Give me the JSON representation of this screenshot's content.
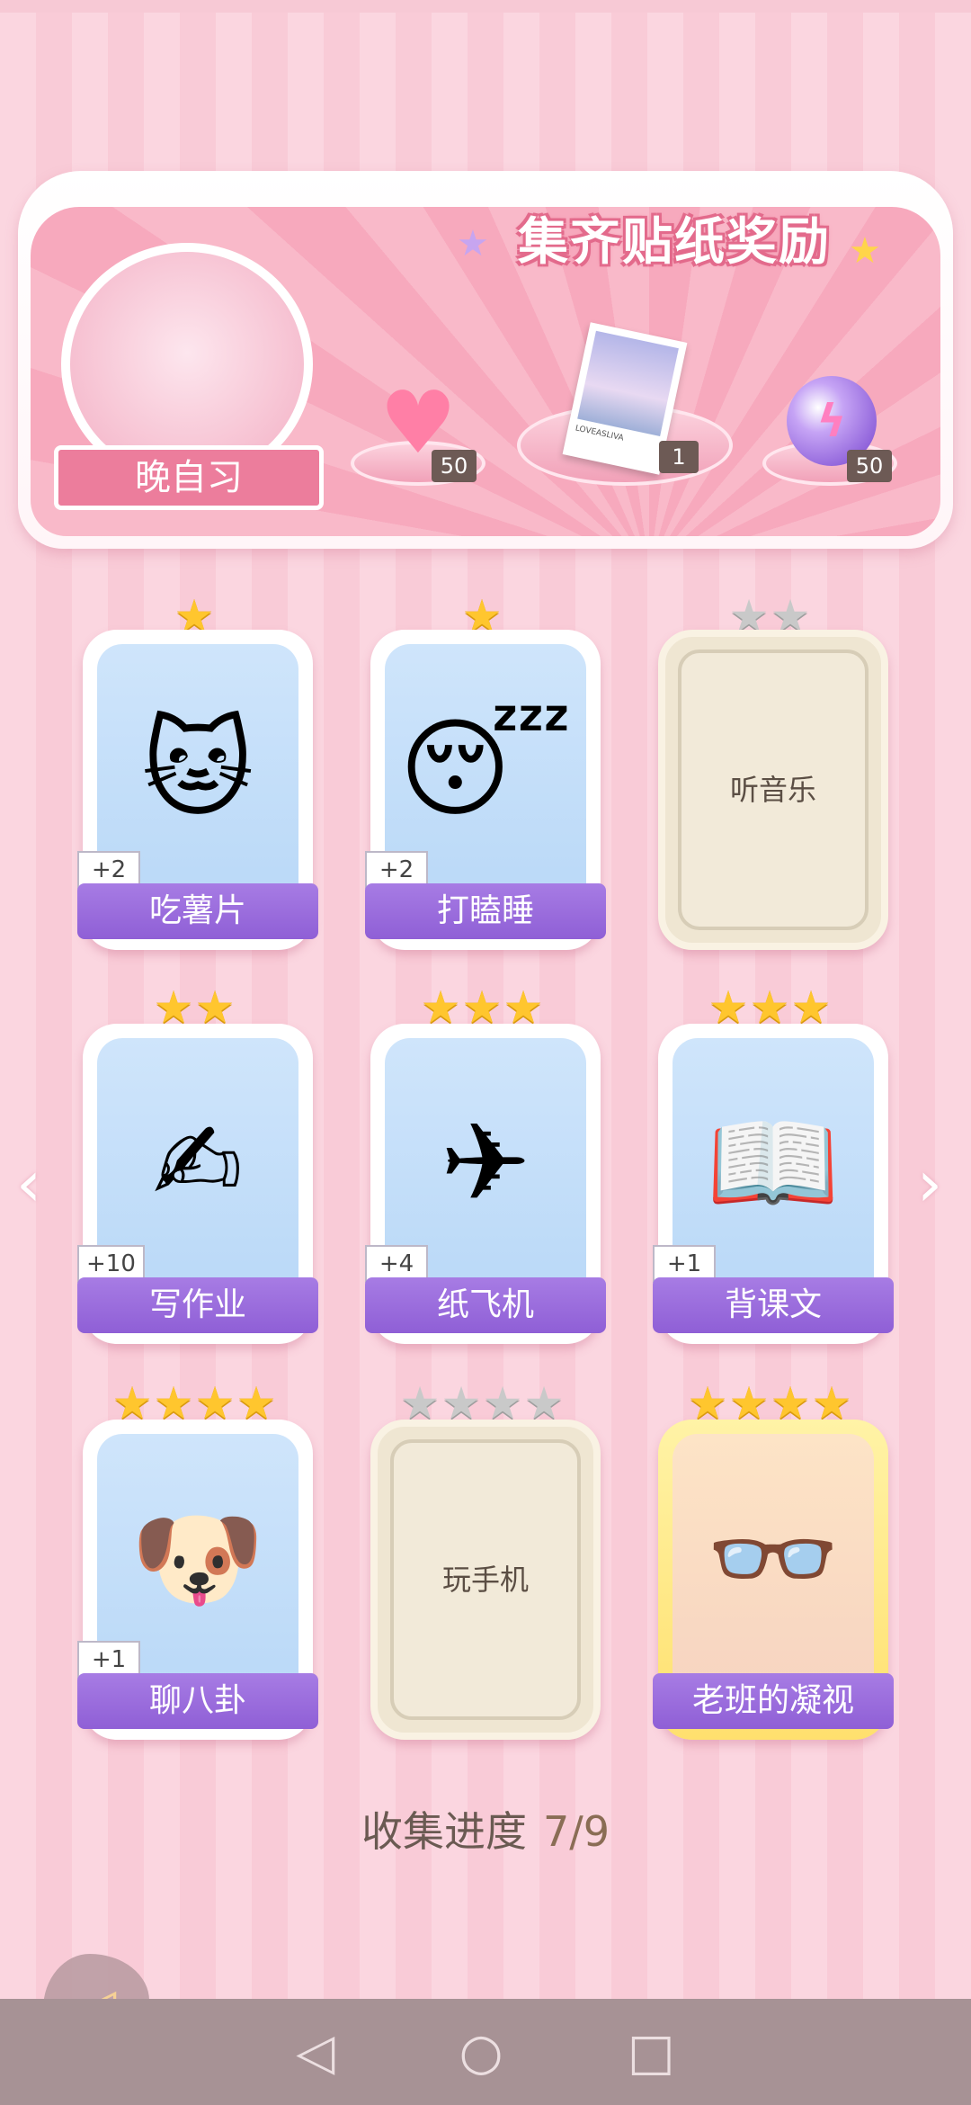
{
  "banner": {
    "title": "集齐贴纸奖励",
    "portrait_label": "晚自习",
    "rewards": [
      {
        "icon": "pink-heart-gem-icon",
        "count": "50"
      },
      {
        "icon": "photo-card-icon",
        "count": "1",
        "caption": "LOVEASLIVA"
      },
      {
        "icon": "purple-energy-orb-icon",
        "count": "50"
      }
    ]
  },
  "cards": [
    {
      "name": "吃薯片",
      "stars": 1,
      "max_stars": 1,
      "plus": "+2",
      "unlocked": true
    },
    {
      "name": "打瞌睡",
      "stars": 1,
      "max_stars": 1,
      "plus": "+2",
      "unlocked": true
    },
    {
      "name": "听音乐",
      "stars": 0,
      "max_stars": 2,
      "unlocked": false
    },
    {
      "name": "写作业",
      "stars": 2,
      "max_stars": 2,
      "plus": "+10",
      "unlocked": true
    },
    {
      "name": "纸飞机",
      "stars": 3,
      "max_stars": 3,
      "plus": "+4",
      "unlocked": true
    },
    {
      "name": "背课文",
      "stars": 3,
      "max_stars": 3,
      "plus": "+1",
      "unlocked": true
    },
    {
      "name": "聊八卦",
      "stars": 4,
      "max_stars": 4,
      "plus": "+1",
      "unlocked": true
    },
    {
      "name": "玩手机",
      "stars": 0,
      "max_stars": 4,
      "unlocked": false
    },
    {
      "name": "老班的凝视",
      "stars": 4,
      "max_stars": 4,
      "unlocked": true,
      "gold": true
    }
  ],
  "progress": {
    "label": "收集进度",
    "value": "7/9"
  },
  "colors": {
    "accent": "#8f5fd6",
    "pink": "#ec7d9c",
    "star": "#ffc62e"
  }
}
